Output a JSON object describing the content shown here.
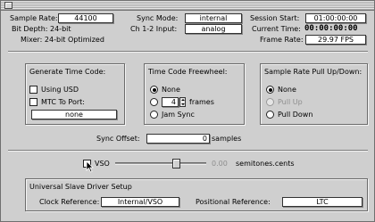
{
  "top": {
    "sample_rate_label": "Sample Rate:",
    "sample_rate_value": "44100",
    "bit_depth": "Bit Depth: 24-bit",
    "mixer": "Mixer: 24-bit Optimized",
    "sync_mode_label": "Sync Mode:",
    "sync_mode_value": "internal",
    "ch12_input_label": "Ch 1-2 Input:",
    "ch12_input_value": "analog",
    "session_start_label": "Session Start:",
    "session_start_value": "01:00:00:00",
    "current_time_label": "Current Time:",
    "current_time_value": "00:00:00:00",
    "frame_rate_label": "Frame Rate:",
    "frame_rate_value": "29.97 FPS"
  },
  "generate_tc": {
    "title": "Generate Time Code:",
    "using_usd": "Using USD",
    "mtc_to_port": "MTC To Port:",
    "port_value": "none"
  },
  "tc_freewheel": {
    "title": "Time Code Freewheel:",
    "none": "None",
    "frames_value": "4",
    "frames_label": "frames",
    "jam_sync": "Jam Sync"
  },
  "pull": {
    "title": "Sample Rate Pull Up/Down:",
    "none": "None",
    "pull_up": "Pull Up",
    "pull_down": "Pull Down"
  },
  "sync_offset": {
    "label": "Sync Offset:",
    "value": "0",
    "unit": "samples"
  },
  "vso": {
    "label": "VSO",
    "readout": "0.00",
    "unit": "semitones.cents"
  },
  "usd": {
    "title": "Universal Slave Driver Setup",
    "clock_ref_label": "Clock Reference:",
    "clock_ref_value": "Internal/VSO",
    "pos_ref_label": "Positional Reference:",
    "pos_ref_value": "LTC"
  },
  "icons": [
    "close-box-icon",
    "mouse-pointer-icon"
  ]
}
